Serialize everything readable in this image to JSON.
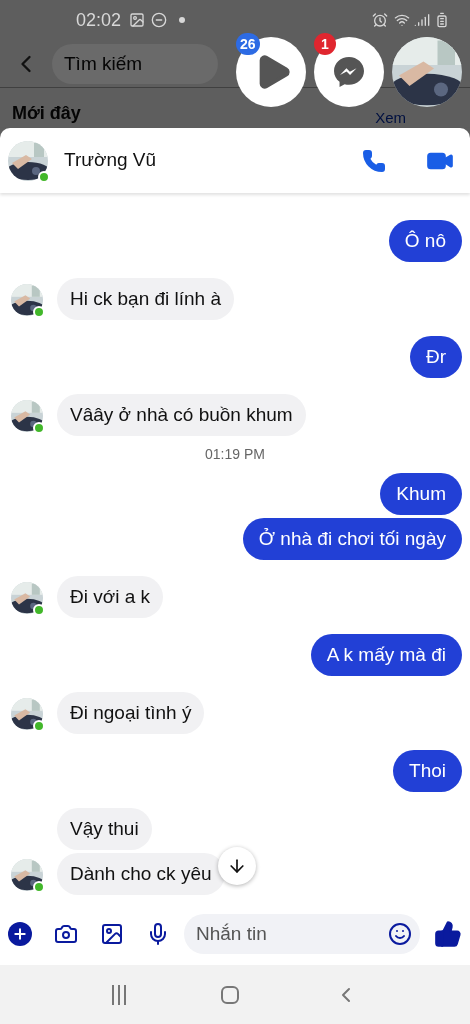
{
  "status_bar": {
    "time": "02:02"
  },
  "background_page": {
    "search": {
      "placeholder": "Tìm kiếm"
    },
    "section_title": "Mới đây",
    "see_all": "Xem"
  },
  "chat_heads": [
    {
      "kind": "video",
      "badge": "26",
      "color": "#2d6be4"
    },
    {
      "kind": "messenger",
      "badge": "1",
      "color": "#e0262f"
    },
    {
      "kind": "avatar"
    }
  ],
  "chat": {
    "name": "Trường Vũ",
    "online": true,
    "messages": [
      {
        "kind": "out",
        "text": "Ô nô"
      },
      {
        "kind": "in",
        "text": "Hi ck bạn đi lính à",
        "avatar": true
      },
      {
        "kind": "out",
        "text": "Đr"
      },
      {
        "kind": "in",
        "text": "Vâây ở nhà có buồn khum",
        "avatar": true
      },
      {
        "kind": "time",
        "text": "01:19 PM"
      },
      {
        "kind": "out",
        "text": "Khum"
      },
      {
        "kind": "out",
        "text": "Ở nhà đi chơi tối ngày"
      },
      {
        "kind": "in",
        "text": "Đi với a k",
        "avatar": true
      },
      {
        "kind": "out",
        "text": "A k mấy mà đi"
      },
      {
        "kind": "in",
        "text": "Đi ngoại tình ý",
        "avatar": true
      },
      {
        "kind": "out",
        "text": "Thoi"
      },
      {
        "kind": "in",
        "text": "Vậy thui",
        "avatar": false
      },
      {
        "kind": "in",
        "text": "Dành cho ck yêu",
        "avatar": true
      }
    ],
    "composer": {
      "placeholder": "Nhắn tin"
    }
  }
}
